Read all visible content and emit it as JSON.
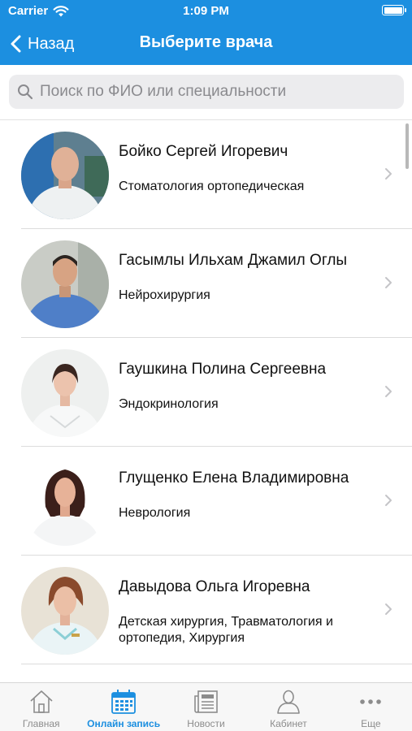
{
  "status_bar": {
    "carrier": "Carrier",
    "time": "1:09 PM"
  },
  "nav": {
    "back_label": "Назад",
    "title": "Выберите врача"
  },
  "search": {
    "placeholder": "Поиск по ФИО или специальности",
    "value": ""
  },
  "doctors": [
    {
      "name": "Бойко Сергей Игоревич",
      "specialty": "Стоматология ортопедическая"
    },
    {
      "name": "Гасымлы Ильхам Джамил Оглы",
      "specialty": "Нейрохирургия"
    },
    {
      "name": "Гаушкина Полина Сергеевна",
      "specialty": "Эндокринология"
    },
    {
      "name": "Глущенко Елена Владимировна",
      "specialty": "Неврология"
    },
    {
      "name": "Давыдова Ольга Игоревна",
      "specialty": "Детская хирургия, Травматология и ортопедия, Хирургия"
    }
  ],
  "tabs": [
    {
      "label": "Главная",
      "icon": "home-icon",
      "active": false
    },
    {
      "label": "Онлайн запись",
      "icon": "calendar-icon",
      "active": true
    },
    {
      "label": "Новости",
      "icon": "newspaper-icon",
      "active": false
    },
    {
      "label": "Кабинет",
      "icon": "person-icon",
      "active": false
    },
    {
      "label": "Еще",
      "icon": "more-icon",
      "active": false
    }
  ],
  "colors": {
    "accent": "#1c8fe0",
    "tab_inactive": "#8c8c8c",
    "divider": "#dcdcdc"
  }
}
